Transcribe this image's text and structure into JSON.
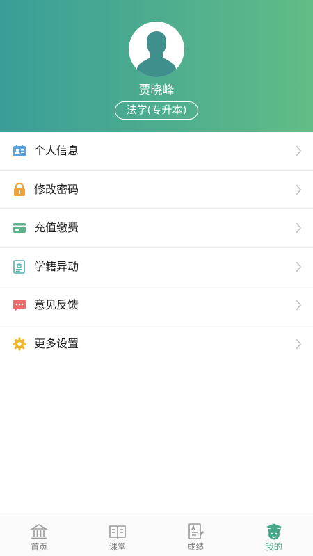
{
  "profile": {
    "name": "贾晓峰",
    "major": "法学(专升本)"
  },
  "menu": [
    {
      "label": "个人信息",
      "icon": "id-card-icon",
      "color": "#5aa3e0"
    },
    {
      "label": "修改密码",
      "icon": "lock-icon",
      "color": "#f0a23a"
    },
    {
      "label": "充值缴费",
      "icon": "card-icon",
      "color": "#5bb58c"
    },
    {
      "label": "学籍异动",
      "icon": "student-record-icon",
      "color": "#4fb0b0"
    },
    {
      "label": "意见反馈",
      "icon": "feedback-icon",
      "color": "#ee6b6b"
    },
    {
      "label": "更多设置",
      "icon": "gear-icon",
      "color": "#f0b429"
    }
  ],
  "tabs": [
    {
      "label": "首页",
      "icon": "home-icon"
    },
    {
      "label": "课堂",
      "icon": "book-icon"
    },
    {
      "label": "成绩",
      "icon": "score-icon"
    },
    {
      "label": "我的",
      "icon": "profile-icon",
      "active": true
    }
  ],
  "colors": {
    "header_start": "#3a9e98",
    "header_end": "#62bc86",
    "accent": "#4aa88a"
  }
}
